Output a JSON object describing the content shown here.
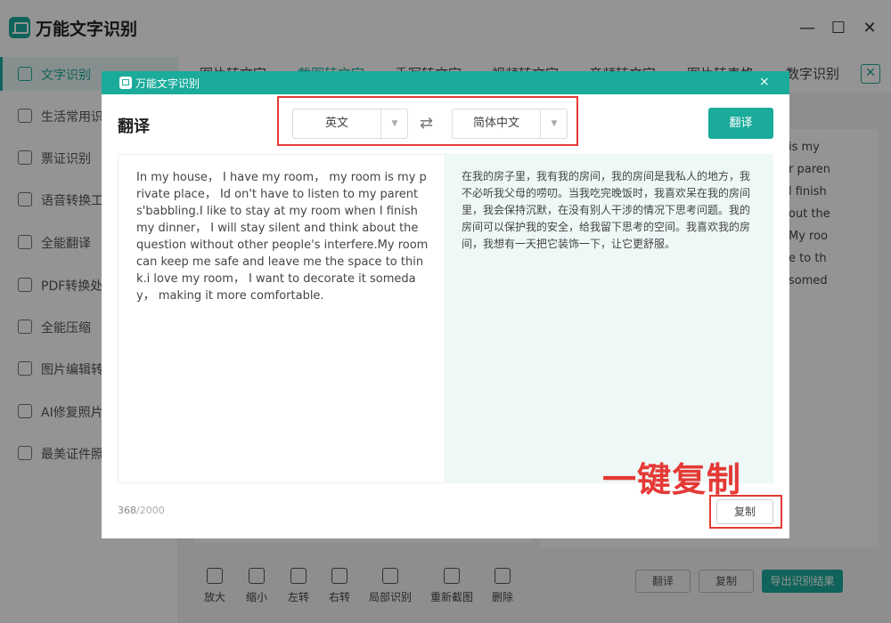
{
  "app": {
    "title": "万能文字识别"
  },
  "window": {
    "minimize": "—",
    "maximize": "☐",
    "close": "✕"
  },
  "sidebar": {
    "items": [
      {
        "label": "文字识别",
        "active": true
      },
      {
        "label": "生活常用识别"
      },
      {
        "label": "票证识别"
      },
      {
        "label": "语音转换工具"
      },
      {
        "label": "全能翻译"
      },
      {
        "label": "PDF转换处理"
      },
      {
        "label": "全能压缩"
      },
      {
        "label": "图片编辑转换"
      },
      {
        "label": "AI修复照片"
      },
      {
        "label": "最美证件照"
      }
    ]
  },
  "tabs": [
    {
      "label": "图片转文字"
    },
    {
      "label": "截图转文字",
      "active": true
    },
    {
      "label": "手写转文字"
    },
    {
      "label": "视频转文字"
    },
    {
      "label": "音频转文字"
    },
    {
      "label": "图片转表格"
    },
    {
      "label": "数字识别"
    }
  ],
  "background_text": [
    "is my",
    "r paren",
    "l finish",
    "out the",
    "My roo",
    "e to th",
    "somed"
  ],
  "toolbar": [
    {
      "label": "放大",
      "icon": "zoom-in-icon"
    },
    {
      "label": "缩小",
      "icon": "zoom-out-icon"
    },
    {
      "label": "左转",
      "icon": "rotate-left-icon"
    },
    {
      "label": "右转",
      "icon": "rotate-right-icon"
    },
    {
      "label": "局部识别",
      "icon": "crop-icon"
    },
    {
      "label": "重新截图",
      "icon": "refresh-icon"
    },
    {
      "label": "删除",
      "icon": "trash-icon"
    }
  ],
  "bottom_buttons": {
    "translate": "翻译",
    "copy": "复制",
    "export": "导出识别结果"
  },
  "modal": {
    "title": "万能文字识别",
    "close": "×",
    "heading": "翻译",
    "source_lang": "英文",
    "target_lang": "简体中文",
    "swap_icon": "⇄",
    "dropdown_icon": "▼",
    "translate_label": "翻译",
    "source_text": "In my house， I have my room， my room is my private place， Id on't have to listen to my parents'babbling.I like to stay at my room when I finish my dinner， I will stay silent and think about the question without other people's interfere.My room can keep me safe and leave me the space to think.i love my room， I want to decorate it someday， making it more comfortable.",
    "translated_text": "在我的房子里，我有我的房间，我的房间是我私人的地方，我不必听我父母的唠叨。当我吃完晚饭时，我喜欢呆在我的房间里，我会保持沉默，在没有别人干涉的情况下思考问题。我的房间可以保护我的安全，给我留下思考的空间。我喜欢我的房间，我想有一天把它装饰一下，让它更舒服。",
    "char_count": "368",
    "char_max": "/2000",
    "copy_label": "复制",
    "annotation": "一键复制"
  },
  "colors": {
    "accent": "#1aab9b",
    "highlight": "#e53935"
  }
}
